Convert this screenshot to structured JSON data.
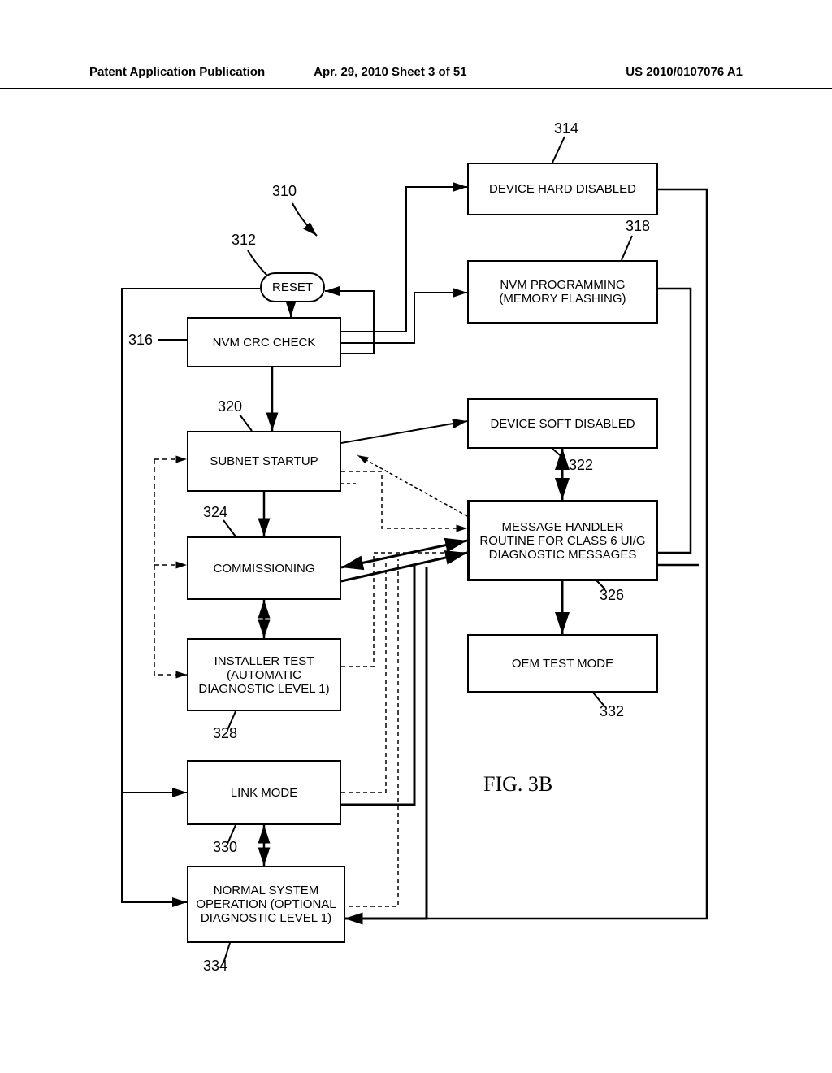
{
  "header": {
    "left": "Patent Application Publication",
    "mid": "Apr. 29, 2010  Sheet 3 of 51",
    "right": "US 2010/0107076 A1"
  },
  "refs": {
    "r310": "310",
    "r312": "312",
    "r314": "314",
    "r316": "316",
    "r318": "318",
    "r320": "320",
    "r322": "322",
    "r324": "324",
    "r326": "326",
    "r328": "328",
    "r330": "330",
    "r332": "332",
    "r334": "334"
  },
  "boxes": {
    "b312": "RESET",
    "b314": "DEVICE HARD DISABLED",
    "b316": "NVM CRC CHECK",
    "b318": "NVM PROGRAMMING (MEMORY FLASHING)",
    "b320": "SUBNET STARTUP",
    "b322": "DEVICE SOFT DISABLED",
    "b324": "COMMISSIONING",
    "b326": "MESSAGE HANDLER ROUTINE FOR CLASS 6 UI/G DIAGNOSTIC MESSAGES",
    "b328": "INSTALLER TEST (AUTOMATIC DIAGNOSTIC LEVEL 1)",
    "b330": "LINK MODE",
    "b332": "OEM TEST MODE",
    "b334": "NORMAL SYSTEM OPERATION (OPTIONAL DIAGNOSTIC LEVEL 1)"
  },
  "figure_label": "FIG. 3B"
}
